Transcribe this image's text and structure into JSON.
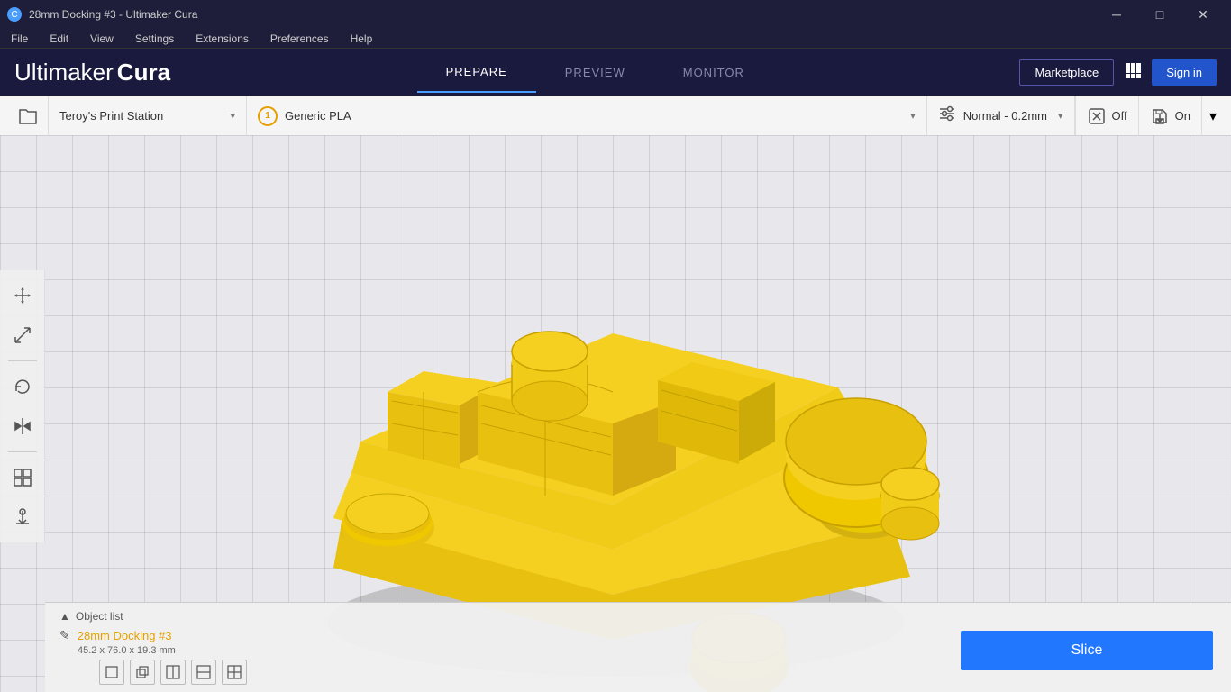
{
  "window": {
    "title": "28mm Docking #3 - Ultimaker Cura",
    "icon": "C"
  },
  "titlebar": {
    "minimize_label": "─",
    "maximize_label": "□",
    "close_label": "✕"
  },
  "menubar": {
    "items": [
      "File",
      "Edit",
      "View",
      "Settings",
      "Extensions",
      "Preferences",
      "Help"
    ]
  },
  "header": {
    "logo_thin": "Ultimaker",
    "logo_bold": " Cura",
    "nav": [
      {
        "label": "PREPARE",
        "active": true
      },
      {
        "label": "PREVIEW",
        "active": false
      },
      {
        "label": "MONITOR",
        "active": false
      }
    ],
    "marketplace_label": "Marketplace",
    "grid_icon": "⋮⋮⋮",
    "signin_label": "Sign in"
  },
  "toolbar": {
    "folder_icon": "📁",
    "printer_name": "Teroy's Print Station",
    "material_badge": "1",
    "material_name": "Generic PLA",
    "profile_icon": "≡",
    "profile_name": "Normal - 0.2mm",
    "support_icon": "✕",
    "support_label": "Off",
    "save_icon": "⬇",
    "save_label": "On",
    "dropdown_arrow": "▾"
  },
  "sidebar": {
    "tools": [
      {
        "name": "move",
        "icon": "✛"
      },
      {
        "name": "scale",
        "icon": "⤡"
      },
      {
        "name": "rotate",
        "icon": "↺"
      },
      {
        "name": "mirror",
        "icon": "⇔"
      },
      {
        "name": "arrange",
        "icon": "⊞"
      },
      {
        "name": "support",
        "icon": "⤓"
      }
    ]
  },
  "bottom": {
    "object_list_label": "Object list",
    "chevron_icon": "▲",
    "object_name": "28mm Docking #3",
    "object_dims": "45.2 x 76.0 x 19.3 mm",
    "edit_icon": "✎",
    "transform_icons": [
      "□",
      "◱",
      "◧",
      "◨",
      "◩"
    ]
  },
  "slice": {
    "button_label": "Slice"
  },
  "colors": {
    "model_yellow": "#f5d020",
    "header_bg": "#1a1a3e",
    "grid_bg": "#e8e8ec",
    "accent_blue": "#2277ff"
  }
}
